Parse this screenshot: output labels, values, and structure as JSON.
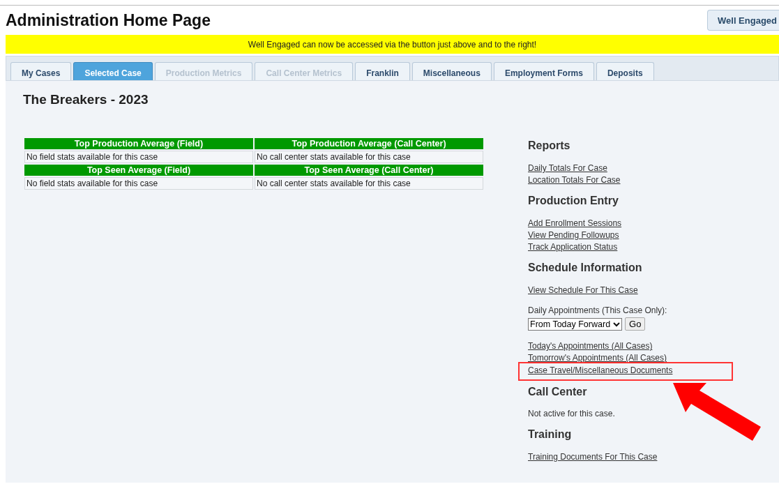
{
  "header": {
    "title": "Administration Home Page",
    "button": "Well Engaged"
  },
  "notice": "Well Engaged can now be accessed via the button just above and to the right!",
  "tabs": [
    {
      "label": "My Cases",
      "selected": false,
      "disabled": false
    },
    {
      "label": "Selected Case",
      "selected": true,
      "disabled": false
    },
    {
      "label": "Production Metrics",
      "selected": false,
      "disabled": true
    },
    {
      "label": "Call Center Metrics",
      "selected": false,
      "disabled": true
    },
    {
      "label": "Franklin",
      "selected": false,
      "disabled": false
    },
    {
      "label": "Miscellaneous",
      "selected": false,
      "disabled": false
    },
    {
      "label": "Employment Forms",
      "selected": false,
      "disabled": false
    },
    {
      "label": "Deposits",
      "selected": false,
      "disabled": false
    }
  ],
  "case_title": "The Breakers - 2023",
  "stats": [
    {
      "columns": [
        "Top Production Average (Field)",
        "Top Production Average (Call Center)"
      ],
      "cells": [
        "No field stats available for this case",
        "No call center stats available for this case"
      ]
    },
    {
      "columns": [
        "Top Seen Average (Field)",
        "Top Seen Average (Call Center)"
      ],
      "cells": [
        "No field stats available for this case",
        "No call center stats available for this case"
      ]
    }
  ],
  "sidebar": {
    "sections": [
      {
        "heading": "Reports",
        "groups": [
          [
            {
              "kind": "link",
              "text": "Daily Totals For Case",
              "highlighted": false
            },
            {
              "kind": "link",
              "text": "Location Totals For Case",
              "highlighted": false
            }
          ]
        ]
      },
      {
        "heading": "Production Entry",
        "groups": [
          [
            {
              "kind": "link",
              "text": "Add Enrollment Sessions",
              "highlighted": false
            },
            {
              "kind": "link",
              "text": "View Pending Followups",
              "highlighted": false
            },
            {
              "kind": "link",
              "text": "Track Application Status",
              "highlighted": false
            }
          ]
        ]
      },
      {
        "heading": "Schedule Information",
        "groups": [
          [
            {
              "kind": "link",
              "text": "View Schedule For This Case",
              "highlighted": false
            }
          ],
          [
            {
              "kind": "label",
              "text": "Daily Appointments (This Case Only):"
            },
            {
              "kind": "select",
              "value": "From Today Forward",
              "button": "Go"
            }
          ],
          [
            {
              "kind": "link",
              "text": "Today's Appointments (All Cases)",
              "highlighted": false
            },
            {
              "kind": "link",
              "text": "Tomorrow's Appointments (All Cases)",
              "highlighted": false
            },
            {
              "kind": "link",
              "text": "Case Travel/Miscellaneous Documents",
              "highlighted": true
            }
          ]
        ]
      },
      {
        "heading": "Call Center",
        "groups": [
          [
            {
              "kind": "label",
              "text": "Not active for this case."
            }
          ]
        ]
      },
      {
        "heading": "Training",
        "groups": [
          [
            {
              "kind": "link",
              "text": "Training Documents For This Case",
              "highlighted": false
            }
          ]
        ]
      }
    ]
  }
}
